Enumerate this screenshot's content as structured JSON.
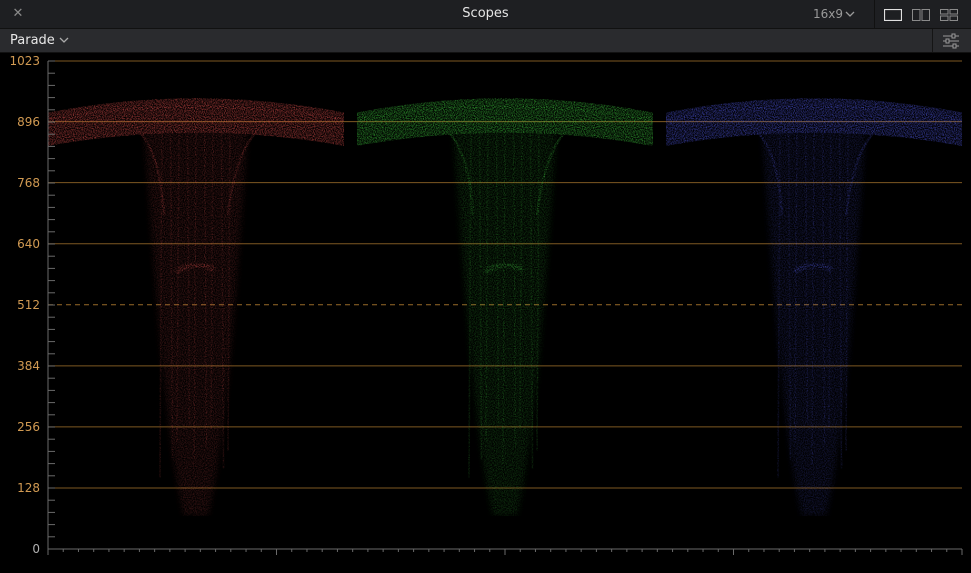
{
  "window": {
    "title": "Scopes",
    "aspect_label": "16x9",
    "layouts": [
      "single-view",
      "dual-view",
      "quad-view"
    ]
  },
  "toolbar": {
    "mode_label": "Parade"
  },
  "scope": {
    "type": "RGB Parade",
    "y_ticks": [
      "1023",
      "896",
      "768",
      "640",
      "512",
      "384",
      "256",
      "128",
      "0"
    ],
    "midline_value": "512",
    "channels": [
      {
        "name": "red",
        "color": "#e0504e"
      },
      {
        "name": "green",
        "color": "#3ecb3e"
      },
      {
        "name": "blue",
        "color": "#5058e6"
      }
    ],
    "colors": {
      "graticule": "#a8762e",
      "label": "#d19a52",
      "background": "#000000"
    }
  }
}
